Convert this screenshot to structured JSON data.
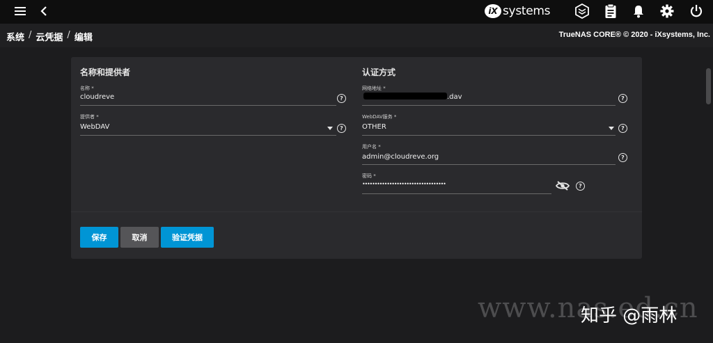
{
  "header": {
    "logo_mark": "iX",
    "logo_text": "systems",
    "icons": [
      "menu-icon",
      "back-icon",
      "truecommand-icon",
      "clipboard-icon",
      "bell-icon",
      "gear-icon",
      "power-icon"
    ]
  },
  "breadcrumb": {
    "items": [
      "系统",
      "云凭据",
      "编辑"
    ],
    "separator": "/"
  },
  "copyright": "TrueNAS CORE® © 2020 - iXsystems, Inc.",
  "form": {
    "left_section_title": "名称和提供者",
    "right_section_title": "认证方式",
    "name": {
      "label": "名称 *",
      "value": "cloudreve"
    },
    "provider": {
      "label": "提供者 *",
      "value": "WebDAV"
    },
    "url": {
      "label": "网络地址 *",
      "value": ".dav"
    },
    "webdav_service": {
      "label": "WebDAV服务 *",
      "value": "OTHER"
    },
    "username": {
      "label": "用户名 *",
      "value": "admin@cloudreve.org"
    },
    "password": {
      "label": "密码 *",
      "value": "••••••••••••••••••••••••••••••••••"
    },
    "help_glyph": "?"
  },
  "buttons": {
    "save": "保存",
    "cancel": "取消",
    "verify": "验证凭据"
  },
  "colors": {
    "primary": "#0095d5",
    "secondary": "#555558",
    "topbar": "#0e0e0e",
    "card": "#2a2a2d"
  },
  "watermark": {
    "site": "www.nas.ed.cn",
    "zhihu": "知乎 @雨林"
  }
}
